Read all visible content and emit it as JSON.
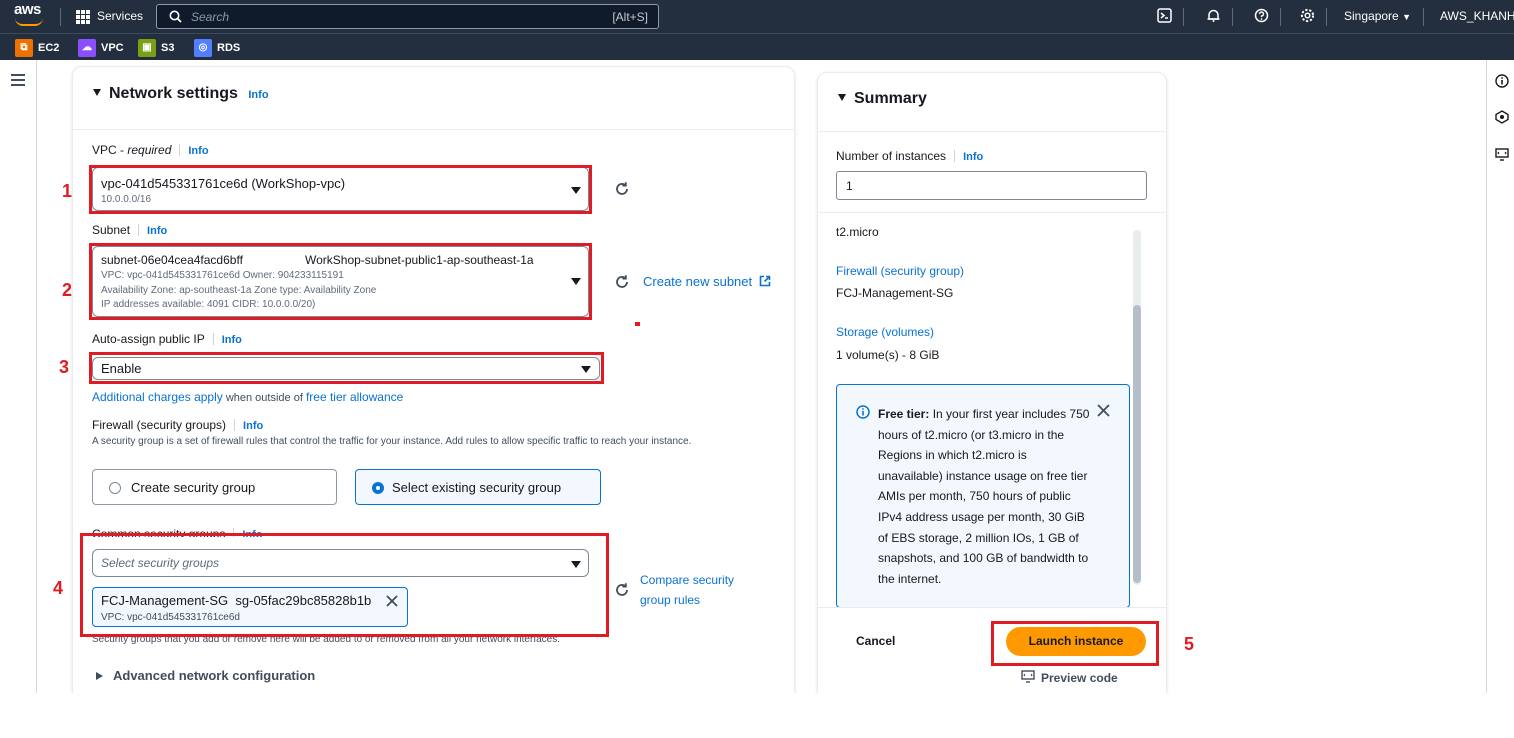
{
  "topbar": {
    "logo": "aws",
    "services_label": "Services",
    "search_placeholder": "Search",
    "search_shortcut": "[Alt+S]",
    "region": "Singapore",
    "user": "AWS_KHANH"
  },
  "favorites": [
    {
      "label": "EC2",
      "color": "#ed7100"
    },
    {
      "label": "VPC",
      "color": "#8c4fff"
    },
    {
      "label": "S3",
      "color": "#7aa116"
    },
    {
      "label": "RDS",
      "color": "#527fff"
    }
  ],
  "network": {
    "title": "Network settings",
    "info": "Info",
    "vpc_label": "VPC - ",
    "vpc_required": "required",
    "vpc_value": "vpc-041d545331761ce6d (WorkShop-vpc)",
    "vpc_cidr": "10.0.0.0/16",
    "subnet_label": "Subnet",
    "subnet_id": "subnet-06e04cea4facd6bff",
    "subnet_name": "WorkShop-subnet-public1-ap-southeast-1a",
    "subnet_line2": "VPC: vpc-041d545331761ce6d    Owner: 904233115191",
    "subnet_line3": "Availability Zone: ap-southeast-1a    Zone type: Availability Zone",
    "subnet_line4": "IP addresses available: 4091    CIDR: 10.0.0.0/20)",
    "create_subnet": "Create new subnet",
    "autoip_label": "Auto-assign public IP",
    "autoip_value": "Enable",
    "charges_link": "Additional charges apply",
    "charges_text": " when outside of ",
    "free_tier_link": "free tier allowance",
    "firewall_label": "Firewall (security groups)",
    "firewall_desc": "A security group is a set of firewall rules that control the traffic for your instance. Add rules to allow specific traffic to reach your instance.",
    "create_sg": "Create security group",
    "select_sg": "Select existing security group",
    "common_sg_label": "Common security groups",
    "sg_placeholder": "Select security groups",
    "token_name": "FCJ-Management-SG",
    "token_id": "sg-05fac29bc85828b1b",
    "token_vpc": "VPC: vpc-041d545331761ce6d",
    "compare_link": "Compare security group rules",
    "sg_note": "Security groups that you add or remove here will be added to or removed from all your network interfaces.",
    "advanced": "Advanced network configuration"
  },
  "summary": {
    "title": "Summary",
    "instances_label": "Number of instances",
    "info": "Info",
    "instances_value": "1",
    "instance_type": "t2.micro",
    "firewall_link": "Firewall (security group)",
    "firewall_value": "FCJ-Management-SG",
    "storage_link": "Storage (volumes)",
    "storage_value": "1 volume(s) - 8 GiB",
    "free_tier_title": "Free tier:",
    "free_tier_text": "In your first year includes 750 hours of t2.micro (or t3.micro in the Regions in which t2.micro is unavailable) instance usage on free tier AMIs per month, 750 hours of public IPv4 address usage per month, 30 GiB of EBS storage, 2 million IOs, 1 GB of snapshots, and 100 GB of bandwidth to the internet.",
    "cancel": "Cancel",
    "launch": "Launch instance",
    "preview": "Preview code"
  },
  "annotations": [
    "1",
    "2",
    "3",
    "4",
    "5"
  ]
}
